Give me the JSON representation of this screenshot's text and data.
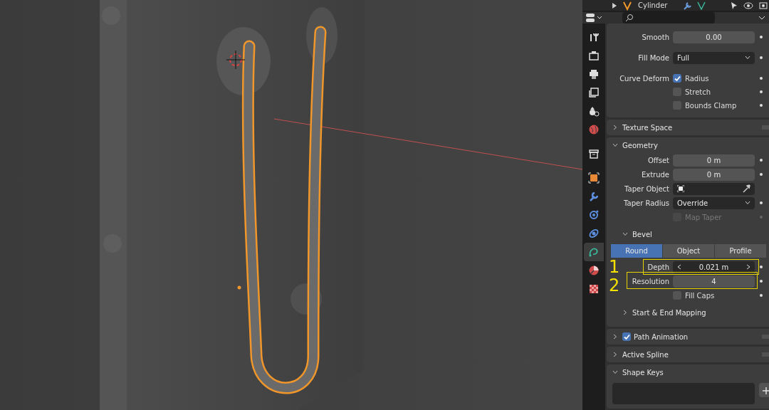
{
  "outliner": {
    "name": "Cylinder"
  },
  "tab_groups": [
    [
      {
        "kind": "tool",
        "selected": false
      },
      {
        "kind": "render",
        "selected": false
      },
      {
        "kind": "output",
        "selected": false
      },
      {
        "kind": "view_layer",
        "selected": false
      },
      {
        "kind": "scene",
        "selected": false
      },
      {
        "kind": "world",
        "selected": false
      }
    ],
    [
      {
        "kind": "collection",
        "selected": false
      }
    ],
    [
      {
        "kind": "object",
        "selected": false
      },
      {
        "kind": "modifier",
        "selected": false
      },
      {
        "kind": "particles",
        "selected": false
      },
      {
        "kind": "physics",
        "selected": false
      },
      {
        "kind": "data",
        "selected": true
      },
      {
        "kind": "material",
        "selected": false
      },
      {
        "kind": "texture",
        "selected": false
      }
    ]
  ],
  "panels": [
    {
      "rows": [
        {
          "kind": "number",
          "label": "Smooth",
          "value": "0.00"
        },
        {
          "kind": "dropdown",
          "label": "Fill Mode",
          "value": "Full"
        },
        {
          "kind": "check",
          "label": "Curve Deform",
          "text": "Radius",
          "checked": true,
          "disabled": false
        },
        {
          "kind": "check",
          "text": "Stretch",
          "checked": false,
          "disabled": false
        },
        {
          "kind": "check",
          "text": "Bounds Clamp",
          "checked": false,
          "disabled": false
        }
      ]
    },
    {
      "title": "Texture Space",
      "expanded": false
    },
    {
      "title": "Geometry",
      "expanded": true,
      "rows": [
        {
          "kind": "number",
          "label": "Offset",
          "value": "0 m"
        },
        {
          "kind": "number",
          "label": "Extrude",
          "value": "0 m"
        },
        {
          "kind": "picker",
          "label": "Taper Object"
        },
        {
          "kind": "dropdown",
          "label": "Taper Radius",
          "value": "Override"
        },
        {
          "kind": "check",
          "text": "Map Taper",
          "checked": false,
          "disabled": true
        },
        {
          "kind": "subpanel",
          "title": "Bevel",
          "expanded": true
        },
        {
          "kind": "segmented",
          "options": [
            {
              "label": "Round",
              "selected": true
            },
            {
              "label": "Object",
              "selected": false
            },
            {
              "label": "Profile",
              "selected": false
            }
          ]
        },
        {
          "kind": "stepper",
          "label": "Depth",
          "value": "0.021 m",
          "annotation": "1"
        },
        {
          "kind": "number",
          "label": "Resolution",
          "value": "4",
          "annotation": "2"
        },
        {
          "kind": "check",
          "text": "Fill Caps",
          "checked": false,
          "disabled": false
        },
        {
          "kind": "subpanel",
          "title": "Start & End Mapping",
          "expanded": false
        }
      ]
    },
    {
      "title": "Path Animation",
      "expanded": false,
      "checked": true
    },
    {
      "title": "Active Spline",
      "expanded": false
    },
    {
      "title": "Shape Keys",
      "expanded": true,
      "rows": [
        {
          "kind": "listbox"
        }
      ]
    }
  ]
}
